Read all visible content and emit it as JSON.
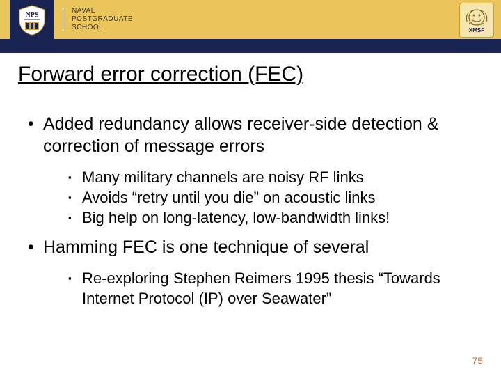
{
  "header": {
    "institution_line1": "NAVAL",
    "institution_line2": "POSTGRADUATE",
    "institution_line3": "SCHOOL",
    "right_logo_label": "XMSF"
  },
  "title": "Forward error correction (FEC)",
  "bullets": [
    {
      "text": "Added redundancy allows receiver-side detection & correction of message errors",
      "sub": [
        "Many military channels are noisy RF links",
        "Avoids “retry until you die” on acoustic links",
        "Big help on long-latency, low-bandwidth links!"
      ]
    },
    {
      "text": "Hamming FEC is one technique of several",
      "sub": [
        "Re-exploring Stephen Reimers 1995 thesis “Towards Internet Protocol (IP) over Seawater”"
      ]
    }
  ],
  "page_number": "75"
}
